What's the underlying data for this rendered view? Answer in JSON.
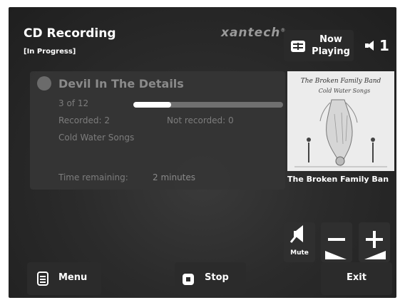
{
  "header": {
    "title": "CD Recording",
    "subtitle": "[In Progress]",
    "brand": "xantech",
    "brand_mark": "®"
  },
  "now_playing": {
    "label_line1": "Now",
    "label_line2": "Playing",
    "icon": "now-playing-icon"
  },
  "zone": {
    "number": "1",
    "icon": "speaker-icon"
  },
  "recording": {
    "track_title": "Devil In The Details",
    "progress_text": "3 of 12",
    "progress_fraction": 0.25,
    "recorded_text": "Recorded: 2",
    "not_recorded_text": "Not recorded: 0",
    "album": "Cold Water Songs",
    "time_remaining_label": "Time remaining:",
    "time_remaining_value": "2 minutes"
  },
  "album_art": {
    "band_name_on_cover": "The Broken Family Band",
    "album_on_cover": "Cold Water Songs",
    "caption": "The Broken Family Ban"
  },
  "volume": {
    "mute_label": "Mute"
  },
  "buttons": {
    "menu": "Menu",
    "stop": "Stop",
    "exit": "Exit"
  },
  "colors": {
    "background": "#2b2b2b",
    "panel": "#353535",
    "text": "#ffffff",
    "muted_text": "#7d7d7d"
  }
}
